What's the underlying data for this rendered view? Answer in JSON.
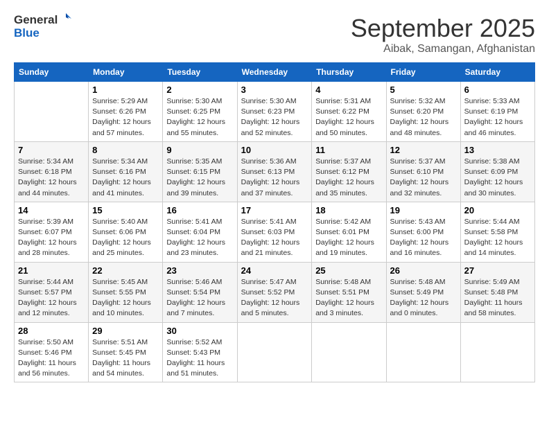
{
  "header": {
    "logo_general": "General",
    "logo_blue": "Blue",
    "month": "September 2025",
    "location": "Aibak, Samangan, Afghanistan"
  },
  "days_of_week": [
    "Sunday",
    "Monday",
    "Tuesday",
    "Wednesday",
    "Thursday",
    "Friday",
    "Saturday"
  ],
  "weeks": [
    [
      {
        "day": "",
        "info": ""
      },
      {
        "day": "1",
        "info": "Sunrise: 5:29 AM\nSunset: 6:26 PM\nDaylight: 12 hours\nand 57 minutes."
      },
      {
        "day": "2",
        "info": "Sunrise: 5:30 AM\nSunset: 6:25 PM\nDaylight: 12 hours\nand 55 minutes."
      },
      {
        "day": "3",
        "info": "Sunrise: 5:30 AM\nSunset: 6:23 PM\nDaylight: 12 hours\nand 52 minutes."
      },
      {
        "day": "4",
        "info": "Sunrise: 5:31 AM\nSunset: 6:22 PM\nDaylight: 12 hours\nand 50 minutes."
      },
      {
        "day": "5",
        "info": "Sunrise: 5:32 AM\nSunset: 6:20 PM\nDaylight: 12 hours\nand 48 minutes."
      },
      {
        "day": "6",
        "info": "Sunrise: 5:33 AM\nSunset: 6:19 PM\nDaylight: 12 hours\nand 46 minutes."
      }
    ],
    [
      {
        "day": "7",
        "info": "Sunrise: 5:34 AM\nSunset: 6:18 PM\nDaylight: 12 hours\nand 44 minutes."
      },
      {
        "day": "8",
        "info": "Sunrise: 5:34 AM\nSunset: 6:16 PM\nDaylight: 12 hours\nand 41 minutes."
      },
      {
        "day": "9",
        "info": "Sunrise: 5:35 AM\nSunset: 6:15 PM\nDaylight: 12 hours\nand 39 minutes."
      },
      {
        "day": "10",
        "info": "Sunrise: 5:36 AM\nSunset: 6:13 PM\nDaylight: 12 hours\nand 37 minutes."
      },
      {
        "day": "11",
        "info": "Sunrise: 5:37 AM\nSunset: 6:12 PM\nDaylight: 12 hours\nand 35 minutes."
      },
      {
        "day": "12",
        "info": "Sunrise: 5:37 AM\nSunset: 6:10 PM\nDaylight: 12 hours\nand 32 minutes."
      },
      {
        "day": "13",
        "info": "Sunrise: 5:38 AM\nSunset: 6:09 PM\nDaylight: 12 hours\nand 30 minutes."
      }
    ],
    [
      {
        "day": "14",
        "info": "Sunrise: 5:39 AM\nSunset: 6:07 PM\nDaylight: 12 hours\nand 28 minutes."
      },
      {
        "day": "15",
        "info": "Sunrise: 5:40 AM\nSunset: 6:06 PM\nDaylight: 12 hours\nand 25 minutes."
      },
      {
        "day": "16",
        "info": "Sunrise: 5:41 AM\nSunset: 6:04 PM\nDaylight: 12 hours\nand 23 minutes."
      },
      {
        "day": "17",
        "info": "Sunrise: 5:41 AM\nSunset: 6:03 PM\nDaylight: 12 hours\nand 21 minutes."
      },
      {
        "day": "18",
        "info": "Sunrise: 5:42 AM\nSunset: 6:01 PM\nDaylight: 12 hours\nand 19 minutes."
      },
      {
        "day": "19",
        "info": "Sunrise: 5:43 AM\nSunset: 6:00 PM\nDaylight: 12 hours\nand 16 minutes."
      },
      {
        "day": "20",
        "info": "Sunrise: 5:44 AM\nSunset: 5:58 PM\nDaylight: 12 hours\nand 14 minutes."
      }
    ],
    [
      {
        "day": "21",
        "info": "Sunrise: 5:44 AM\nSunset: 5:57 PM\nDaylight: 12 hours\nand 12 minutes."
      },
      {
        "day": "22",
        "info": "Sunrise: 5:45 AM\nSunset: 5:55 PM\nDaylight: 12 hours\nand 10 minutes."
      },
      {
        "day": "23",
        "info": "Sunrise: 5:46 AM\nSunset: 5:54 PM\nDaylight: 12 hours\nand 7 minutes."
      },
      {
        "day": "24",
        "info": "Sunrise: 5:47 AM\nSunset: 5:52 PM\nDaylight: 12 hours\nand 5 minutes."
      },
      {
        "day": "25",
        "info": "Sunrise: 5:48 AM\nSunset: 5:51 PM\nDaylight: 12 hours\nand 3 minutes."
      },
      {
        "day": "26",
        "info": "Sunrise: 5:48 AM\nSunset: 5:49 PM\nDaylight: 12 hours\nand 0 minutes."
      },
      {
        "day": "27",
        "info": "Sunrise: 5:49 AM\nSunset: 5:48 PM\nDaylight: 11 hours\nand 58 minutes."
      }
    ],
    [
      {
        "day": "28",
        "info": "Sunrise: 5:50 AM\nSunset: 5:46 PM\nDaylight: 11 hours\nand 56 minutes."
      },
      {
        "day": "29",
        "info": "Sunrise: 5:51 AM\nSunset: 5:45 PM\nDaylight: 11 hours\nand 54 minutes."
      },
      {
        "day": "30",
        "info": "Sunrise: 5:52 AM\nSunset: 5:43 PM\nDaylight: 11 hours\nand 51 minutes."
      },
      {
        "day": "",
        "info": ""
      },
      {
        "day": "",
        "info": ""
      },
      {
        "day": "",
        "info": ""
      },
      {
        "day": "",
        "info": ""
      }
    ]
  ]
}
